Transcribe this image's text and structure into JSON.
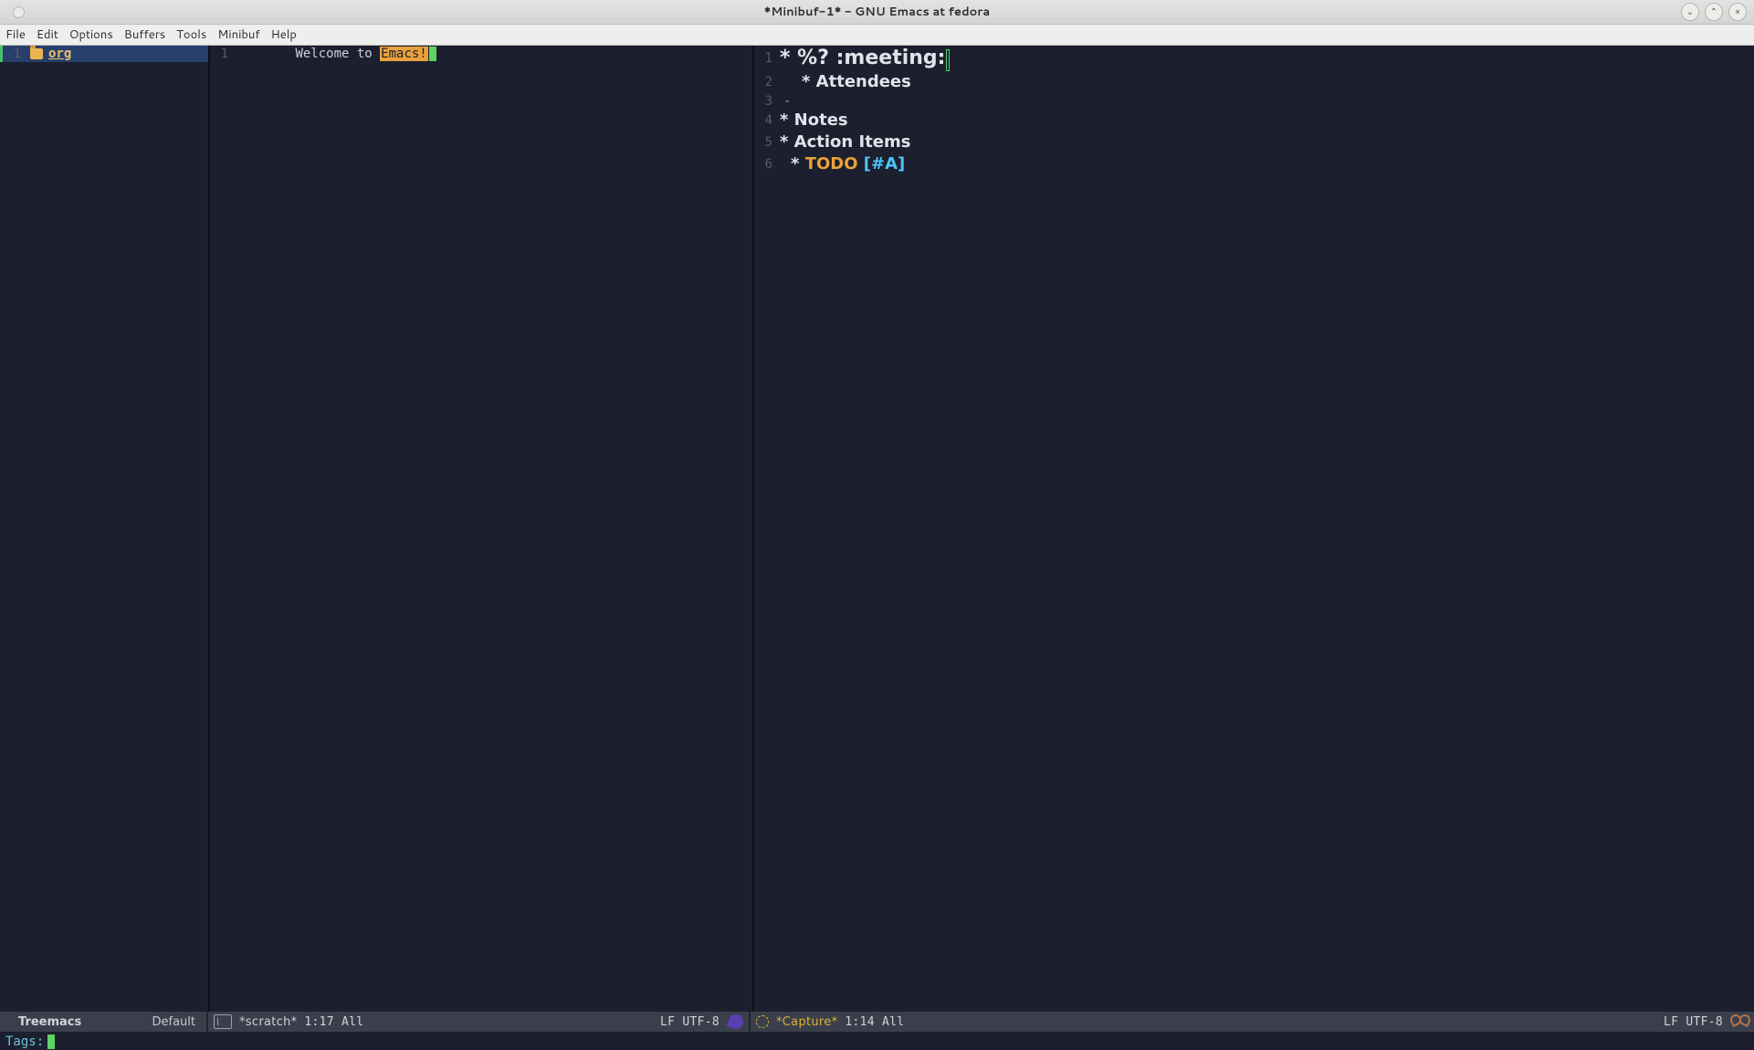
{
  "window": {
    "title": "*Minibuf-1* - GNU Emacs at fedora"
  },
  "menu": {
    "items": [
      "File",
      "Edit",
      "Options",
      "Buffers",
      "Tools",
      "Minibuf",
      "Help"
    ]
  },
  "treemacs": {
    "line1_gutter": "1",
    "root_label": "org"
  },
  "scratch": {
    "line1_gutter": "1",
    "text_prefix": "Welcome to ",
    "text_highlight": "Emacs!"
  },
  "capture": {
    "lines": [
      {
        "gutter": "1",
        "kind": "h1",
        "text": "* %? :meeting:"
      },
      {
        "gutter": "2",
        "kind": "h2",
        "indent": 1,
        "text": "* Attendees"
      },
      {
        "gutter": "3",
        "kind": "dash",
        "text": "-"
      },
      {
        "gutter": "4",
        "kind": "h2",
        "text": "* Notes"
      },
      {
        "gutter": "5",
        "kind": "h2",
        "text": "* Action Items"
      },
      {
        "gutter": "6",
        "kind": "todo",
        "indent": 1,
        "star": "* ",
        "todo": "TODO",
        "prio": " [#A]"
      }
    ]
  },
  "modeline": {
    "left": {
      "name": "Treemacs",
      "right": "Default"
    },
    "mid": {
      "name": "*scratch*",
      "pos": "1:17 All",
      "enc": "LF UTF-8"
    },
    "right": {
      "name": "*Capture*",
      "pos": "1:14 All",
      "enc": "LF UTF-8"
    }
  },
  "minibuffer": {
    "prompt": "Tags:"
  }
}
